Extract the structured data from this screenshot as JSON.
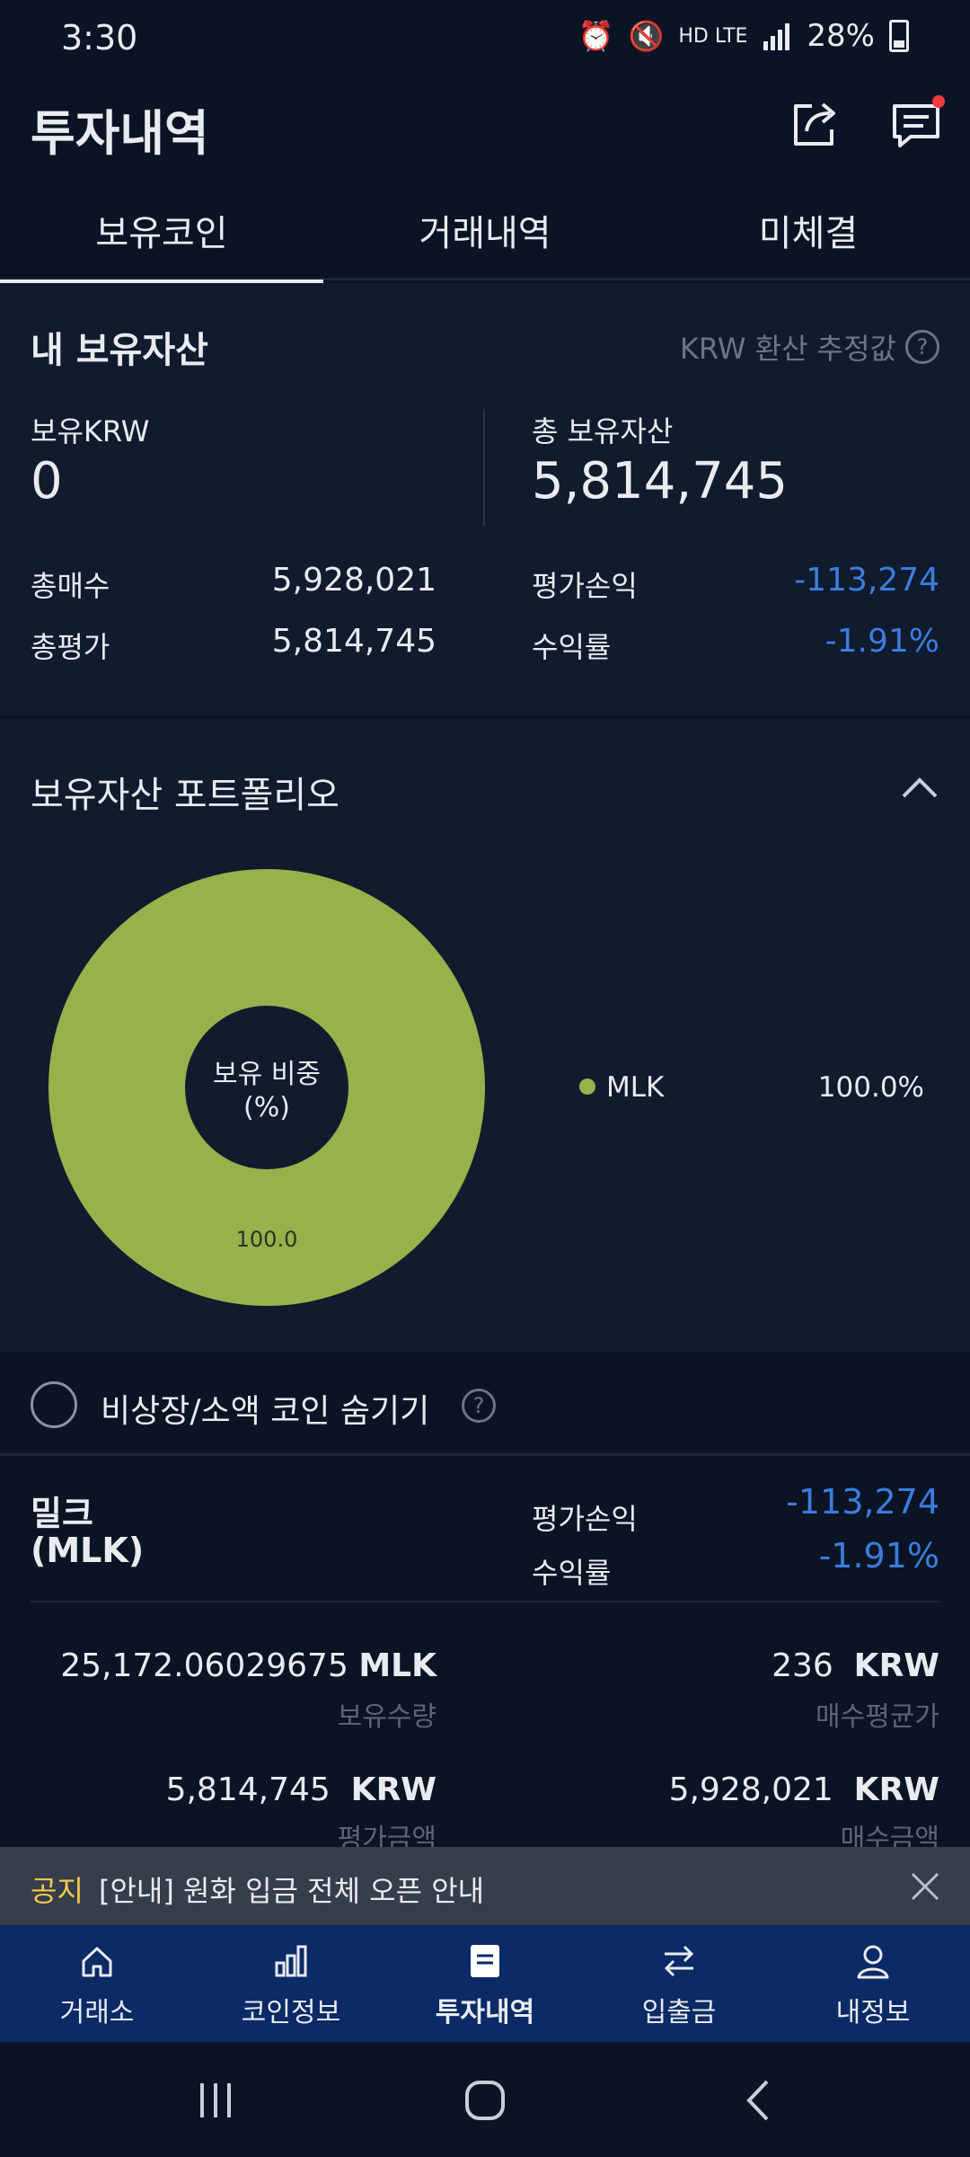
{
  "status_bar": {
    "time": "3:30",
    "network": "HD LTE",
    "battery": "28%"
  },
  "header": {
    "title": "투자내역"
  },
  "tabs": [
    {
      "label": "보유코인",
      "active": true
    },
    {
      "label": "거래내역",
      "active": false
    },
    {
      "label": "미체결",
      "active": false
    }
  ],
  "assets": {
    "title": "내 보유자산",
    "krw_note": "KRW 환산 추정값",
    "held_krw_label": "보유KRW",
    "held_krw_value": "0",
    "total_assets_label": "총 보유자산",
    "total_assets_value": "5,814,745",
    "total_buy_label": "총매수",
    "total_buy_value": "5,928,021",
    "total_eval_label": "총평가",
    "total_eval_value": "5,814,745",
    "pnl_label": "평가손익",
    "pnl_value": "-113,274",
    "return_label": "수익률",
    "return_value": "-1.91%"
  },
  "portfolio": {
    "title": "보유자산 포트폴리오",
    "donut_center_line1": "보유 비중",
    "donut_center_line2": "(%)",
    "slice_label": "100.0",
    "legend": [
      {
        "name": "MLK",
        "percent": "100.0%",
        "color": "#97b14b"
      }
    ]
  },
  "chart_data": {
    "type": "pie",
    "categories": [
      "MLK"
    ],
    "values": [
      100.0
    ],
    "title": "",
    "colors": [
      "#97b14b"
    ]
  },
  "hide_small": {
    "label": "비상장/소액 코인 숨기기"
  },
  "coin": {
    "name": "밀크",
    "symbol": "(MLK)",
    "pnl_label": "평가손익",
    "pnl_value": "-113,274",
    "return_label": "수익률",
    "return_value": "-1.91%",
    "quantity_value": "25,172.06029675",
    "quantity_unit": "MLK",
    "quantity_label": "보유수량",
    "avg_price_value": "236",
    "avg_price_unit": "KRW",
    "avg_price_label": "매수평균가",
    "eval_amount_value": "5,814,745",
    "eval_amount_unit": "KRW",
    "eval_amount_label": "평가금액",
    "buy_amount_value": "5,928,021",
    "buy_amount_unit": "KRW",
    "buy_amount_label": "매수금액"
  },
  "notice": {
    "tag": "공지",
    "text": "[안내] 원화 입금 전체 오픈 안내"
  },
  "bottom_nav": [
    {
      "label": "거래소",
      "icon": "home-icon"
    },
    {
      "label": "코인정보",
      "icon": "bar-chart-icon"
    },
    {
      "label": "투자내역",
      "icon": "list-icon",
      "active": true
    },
    {
      "label": "입출금",
      "icon": "transfer-icon"
    },
    {
      "label": "내정보",
      "icon": "person-icon"
    }
  ]
}
